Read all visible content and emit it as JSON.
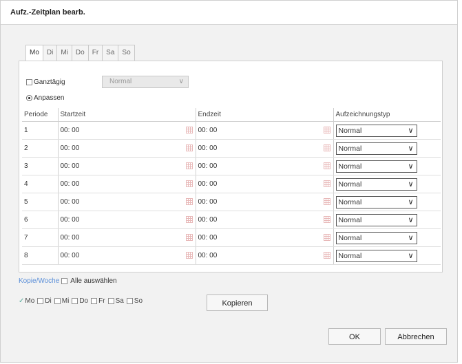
{
  "dialog": {
    "title": "Aufz.-Zeitplan bearb."
  },
  "tabs": [
    "Mo",
    "Di",
    "Mi",
    "Do",
    "Fr",
    "Sa",
    "So"
  ],
  "active_tab": "Mo",
  "mode": {
    "all_day_label": "Ganztägig",
    "all_day_type": "Normal",
    "custom_label": "Anpassen",
    "selected": "Anpassen"
  },
  "table": {
    "headers": {
      "period": "Periode",
      "start": "Startzeit",
      "end": "Endzeit",
      "type": "Aufzeichnungstyp"
    },
    "rows": [
      {
        "period": "1",
        "start": "00: 00",
        "end": "00: 00",
        "type": "Normal"
      },
      {
        "period": "2",
        "start": "00: 00",
        "end": "00: 00",
        "type": "Normal"
      },
      {
        "period": "3",
        "start": "00: 00",
        "end": "00: 00",
        "type": "Normal"
      },
      {
        "period": "4",
        "start": "00: 00",
        "end": "00: 00",
        "type": "Normal"
      },
      {
        "period": "5",
        "start": "00: 00",
        "end": "00: 00",
        "type": "Normal"
      },
      {
        "period": "6",
        "start": "00: 00",
        "end": "00: 00",
        "type": "Normal"
      },
      {
        "period": "7",
        "start": "00: 00",
        "end": "00: 00",
        "type": "Normal"
      },
      {
        "period": "8",
        "start": "00: 00",
        "end": "00: 00",
        "type": "Normal"
      }
    ]
  },
  "copy": {
    "link_label": "Kopie/Woche",
    "select_all_label": "Alle auswählen",
    "days": [
      "Mo",
      "Di",
      "Mi",
      "Do",
      "Fr",
      "Sa",
      "So"
    ],
    "checked_day": "Mo",
    "copy_button": "Kopieren"
  },
  "buttons": {
    "ok": "OK",
    "cancel": "Abbrechen"
  }
}
